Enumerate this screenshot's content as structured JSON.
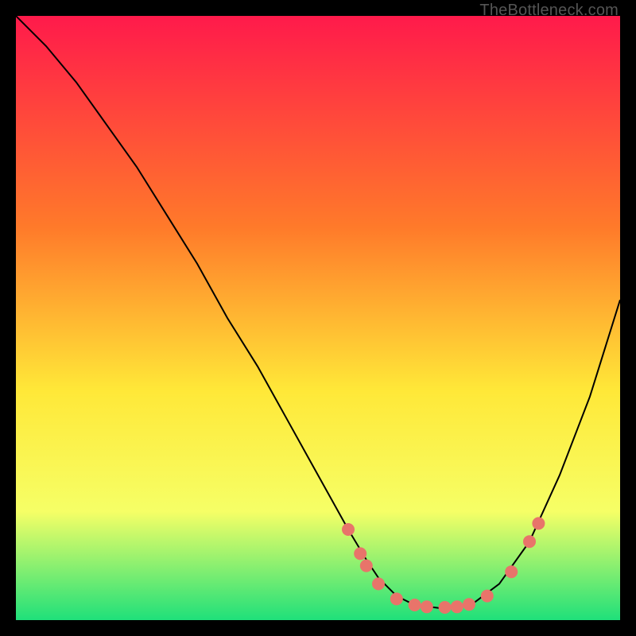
{
  "attribution": "TheBottleneck.com",
  "colors": {
    "gradient_top": "#ff1a4b",
    "gradient_mid1": "#ff7a2a",
    "gradient_mid2": "#ffe838",
    "gradient_mid3": "#f6ff66",
    "gradient_bottom": "#1fe07a",
    "curve": "#000000",
    "marker": "#e8746a",
    "frame": "#000000"
  },
  "chart_data": {
    "type": "line",
    "title": "",
    "xlabel": "",
    "ylabel": "",
    "xlim": [
      0,
      100
    ],
    "ylim": [
      0,
      100
    ],
    "grid": false,
    "series": [
      {
        "name": "bottleneck-curve",
        "x": [
          0,
          5,
          10,
          15,
          20,
          25,
          30,
          35,
          40,
          45,
          50,
          55,
          58,
          60,
          63,
          66,
          70,
          73,
          76,
          80,
          85,
          90,
          95,
          100
        ],
        "y": [
          100,
          95,
          89,
          82,
          75,
          67,
          59,
          50,
          42,
          33,
          24,
          15,
          10,
          7,
          4,
          2.5,
          2,
          2.2,
          3,
          6,
          13,
          24,
          37,
          53
        ]
      }
    ],
    "markers": [
      {
        "x": 55,
        "y": 15
      },
      {
        "x": 57,
        "y": 11
      },
      {
        "x": 58,
        "y": 9
      },
      {
        "x": 60,
        "y": 6
      },
      {
        "x": 63,
        "y": 3.5
      },
      {
        "x": 66,
        "y": 2.5
      },
      {
        "x": 68,
        "y": 2.2
      },
      {
        "x": 71,
        "y": 2.1
      },
      {
        "x": 73,
        "y": 2.2
      },
      {
        "x": 75,
        "y": 2.6
      },
      {
        "x": 78,
        "y": 4
      },
      {
        "x": 82,
        "y": 8
      },
      {
        "x": 85,
        "y": 13
      },
      {
        "x": 86.5,
        "y": 16
      }
    ]
  }
}
